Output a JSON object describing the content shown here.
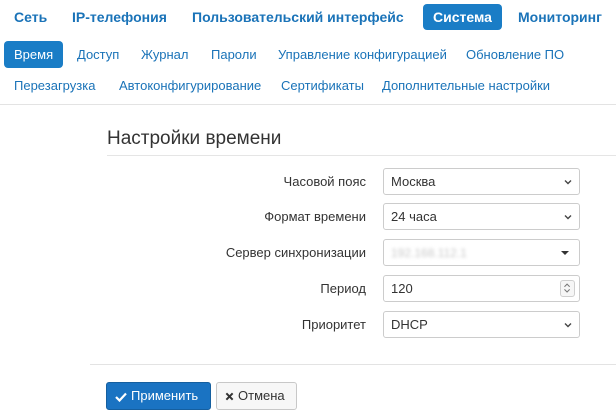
{
  "topnav": {
    "tabs": [
      {
        "label": "Сеть",
        "active": false
      },
      {
        "label": "IP-телефония",
        "active": false
      },
      {
        "label": "Пользовательский интерфейс",
        "active": false
      },
      {
        "label": "Система",
        "active": true
      },
      {
        "label": "Мониторинг",
        "active": false
      }
    ]
  },
  "subnav": {
    "items": [
      {
        "label": "Время",
        "active": true
      },
      {
        "label": "Доступ"
      },
      {
        "label": "Журнал"
      },
      {
        "label": "Пароли"
      },
      {
        "label": "Управление конфигурацией"
      },
      {
        "label": "Обновление ПО"
      },
      {
        "label": "Перезагрузка"
      },
      {
        "label": "Автоконфигурирование"
      },
      {
        "label": "Сертификаты"
      },
      {
        "label": "Дополнительные настройки"
      }
    ]
  },
  "form": {
    "title": "Настройки времени",
    "fields": {
      "timezone": {
        "label": "Часовой пояс",
        "value": "Москва"
      },
      "time_format": {
        "label": "Формат времени",
        "value": "24 часа"
      },
      "sync_server": {
        "label": "Сервер синхронизации",
        "value": "192.168.112.1"
      },
      "period": {
        "label": "Период",
        "value": "120"
      },
      "priority": {
        "label": "Приоритет",
        "value": "DHCP"
      }
    }
  },
  "actions": {
    "apply_label": "Применить",
    "cancel_label": "Отмена"
  },
  "colors": {
    "accent": "#1a7dc6",
    "link": "#1a73b8",
    "primary_button": "#1a73c2"
  }
}
